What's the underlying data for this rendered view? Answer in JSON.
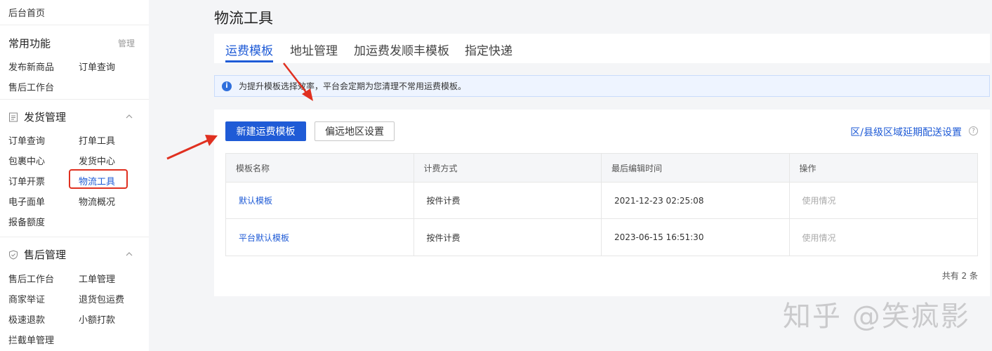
{
  "sidebar": {
    "home": "后台首页",
    "common": {
      "title": "常用功能",
      "manage": "管理",
      "items": [
        "发布新商品",
        "订单查询",
        "售后工作台"
      ]
    },
    "shipping": {
      "title": "发货管理",
      "items": [
        "订单查询",
        "打单工具",
        "包裹中心",
        "发货中心",
        "订单开票",
        "物流工具",
        "电子面单",
        "物流概况",
        "报备额度"
      ]
    },
    "aftersale": {
      "title": "售后管理",
      "items": [
        "售后工作台",
        "工单管理",
        "商家举证",
        "退货包运费",
        "极速退款",
        "小额打款",
        "拦截单管理"
      ]
    }
  },
  "page": {
    "title": "物流工具"
  },
  "tabs": [
    "运费模板",
    "地址管理",
    "加运费发顺丰模板",
    "指定快递"
  ],
  "notice": {
    "icon": "i",
    "text": "为提升模板选择效率，平台会定期为您清理不常用运费模板。"
  },
  "toolbar": {
    "new_template": "新建运费模板",
    "remote_area": "偏远地区设置",
    "delay_link": "区/县级区域延期配送设置",
    "help": "?"
  },
  "table": {
    "headers": [
      "模板名称",
      "计费方式",
      "最后编辑时间",
      "操作"
    ],
    "rows": [
      [
        "默认模板",
        "按件计费",
        "2021-12-23 02:25:08",
        "使用情况"
      ],
      [
        "平台默认模板",
        "按件计费",
        "2023-06-15 16:51:30",
        "使用情况"
      ]
    ]
  },
  "total": "共有 2 条",
  "watermark": "知乎 @笑疯影",
  "colors": {
    "accent": "#1f5bd6",
    "highlight": "#e03020"
  }
}
